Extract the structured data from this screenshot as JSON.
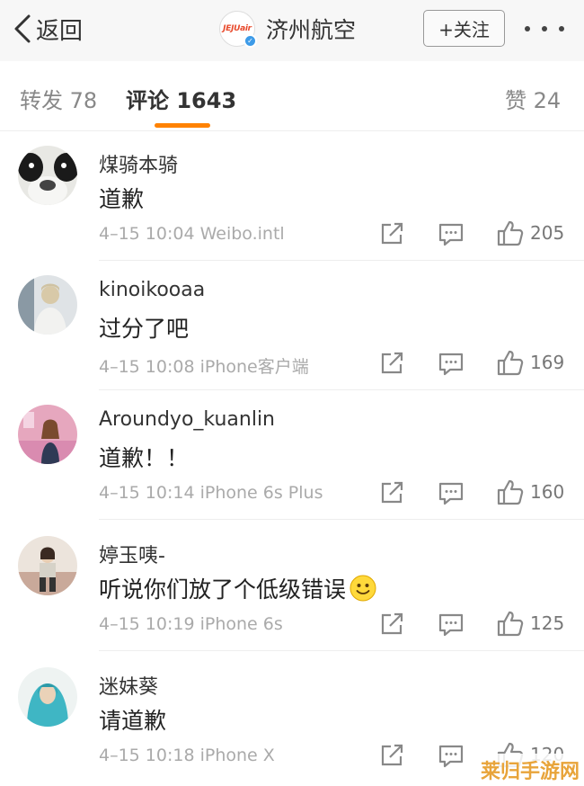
{
  "header": {
    "back_label": "返回",
    "logo_text": "JEJUair",
    "title": "济州航空",
    "follow_label": "+关注"
  },
  "tabs": {
    "repost": "转发 78",
    "comments": "评论 1643",
    "likes": "赞 24"
  },
  "comments": [
    {
      "user": "煤骑本骑",
      "text": "道歉",
      "meta": "4–15 10:04 Weibo.intl",
      "likes": "205"
    },
    {
      "user": "kinoikooaa",
      "text": "过分了吧",
      "meta": "4–15 10:08 iPhone客户端",
      "likes": "169"
    },
    {
      "user": "Aroundyo_kuanlin",
      "text": "道歉！！",
      "meta": "4–15 10:14 iPhone 6s Plus",
      "likes": "160"
    },
    {
      "user": "婷玉咦-",
      "text": "听说你们放了个低级错误",
      "meta": "4–15 10:19 iPhone 6s",
      "likes": "125"
    },
    {
      "user": "迷妹葵",
      "text": "请道歉",
      "meta": "4–15 10:18 iPhone X",
      "likes": "120"
    }
  ],
  "watermark": "莱归手游网",
  "colors": {
    "accent": "#ff8200",
    "verified": "#3d9be8"
  }
}
